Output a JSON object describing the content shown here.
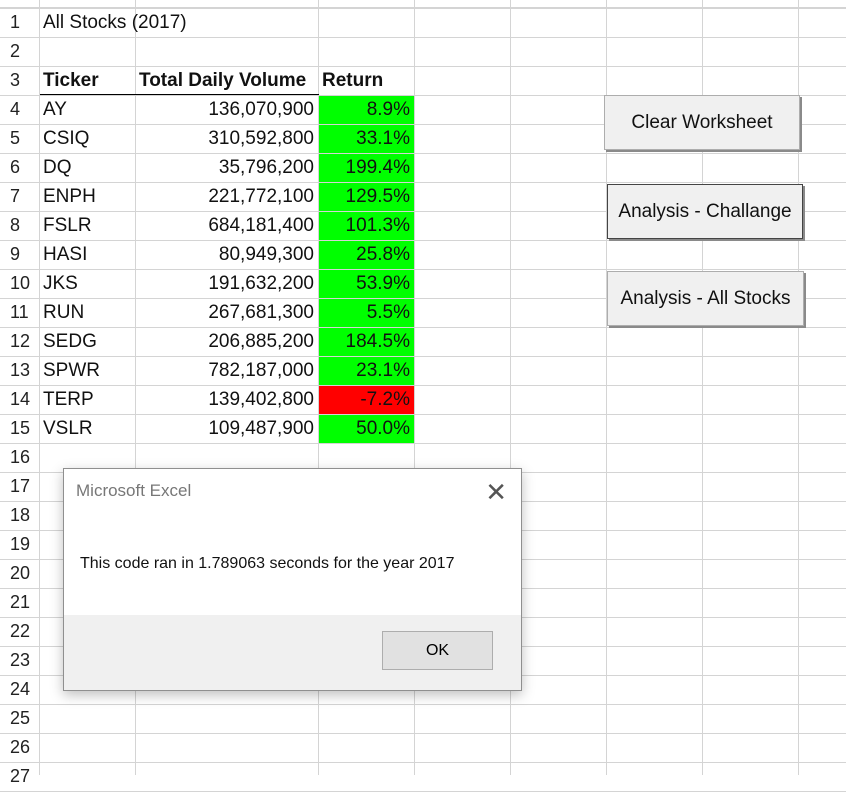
{
  "sheet": {
    "title": "All Stocks (2017)",
    "headers": {
      "ticker": "Ticker",
      "volume": "Total Daily Volume",
      "return": "Return"
    },
    "row_numbers": [
      "1",
      "2",
      "3",
      "4",
      "5",
      "6",
      "7",
      "8",
      "9",
      "10",
      "11",
      "12",
      "13",
      "14",
      "15",
      "16",
      "17",
      "18",
      "19",
      "20",
      "21",
      "22",
      "23",
      "24",
      "25",
      "26",
      "27"
    ],
    "rows": [
      {
        "ticker": "AY",
        "volume": "136,070,900",
        "return": "8.9%",
        "status": "positive"
      },
      {
        "ticker": "CSIQ",
        "volume": "310,592,800",
        "return": "33.1%",
        "status": "positive"
      },
      {
        "ticker": "DQ",
        "volume": "35,796,200",
        "return": "199.4%",
        "status": "positive"
      },
      {
        "ticker": "ENPH",
        "volume": "221,772,100",
        "return": "129.5%",
        "status": "positive"
      },
      {
        "ticker": "FSLR",
        "volume": "684,181,400",
        "return": "101.3%",
        "status": "positive"
      },
      {
        "ticker": "HASI",
        "volume": "80,949,300",
        "return": "25.8%",
        "status": "positive"
      },
      {
        "ticker": "JKS",
        "volume": "191,632,200",
        "return": "53.9%",
        "status": "positive"
      },
      {
        "ticker": "RUN",
        "volume": "267,681,300",
        "return": "5.5%",
        "status": "positive"
      },
      {
        "ticker": "SEDG",
        "volume": "206,885,200",
        "return": "184.5%",
        "status": "positive"
      },
      {
        "ticker": "SPWR",
        "volume": "782,187,000",
        "return": "23.1%",
        "status": "positive"
      },
      {
        "ticker": "TERP",
        "volume": "139,402,800",
        "return": "-7.2%",
        "status": "negative"
      },
      {
        "ticker": "VSLR",
        "volume": "109,487,900",
        "return": "50.0%",
        "status": "positive"
      }
    ]
  },
  "buttons": {
    "clear": "Clear Worksheet",
    "challenge": "Analysis - Challange",
    "all_stocks": "Analysis - All Stocks"
  },
  "dialog": {
    "title": "Microsoft Excel",
    "message": "This code ran in 1.789063 seconds for the year 2017",
    "ok": "OK",
    "close_icon": "close-icon"
  },
  "colors": {
    "positive": "#00ff00",
    "negative": "#ff0000",
    "gridline": "#d4d4d4"
  }
}
